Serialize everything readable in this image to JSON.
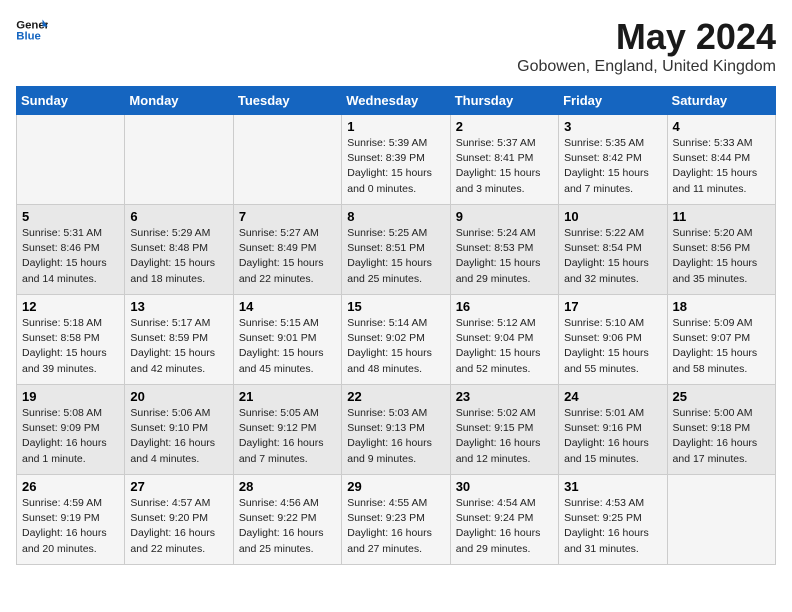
{
  "header": {
    "logo_line1": "General",
    "logo_line2": "Blue",
    "month": "May 2024",
    "location": "Gobowen, England, United Kingdom"
  },
  "weekdays": [
    "Sunday",
    "Monday",
    "Tuesday",
    "Wednesday",
    "Thursday",
    "Friday",
    "Saturday"
  ],
  "weeks": [
    [
      {
        "day": "",
        "info": ""
      },
      {
        "day": "",
        "info": ""
      },
      {
        "day": "",
        "info": ""
      },
      {
        "day": "1",
        "info": "Sunrise: 5:39 AM\nSunset: 8:39 PM\nDaylight: 15 hours\nand 0 minutes."
      },
      {
        "day": "2",
        "info": "Sunrise: 5:37 AM\nSunset: 8:41 PM\nDaylight: 15 hours\nand 3 minutes."
      },
      {
        "day": "3",
        "info": "Sunrise: 5:35 AM\nSunset: 8:42 PM\nDaylight: 15 hours\nand 7 minutes."
      },
      {
        "day": "4",
        "info": "Sunrise: 5:33 AM\nSunset: 8:44 PM\nDaylight: 15 hours\nand 11 minutes."
      }
    ],
    [
      {
        "day": "5",
        "info": "Sunrise: 5:31 AM\nSunset: 8:46 PM\nDaylight: 15 hours\nand 14 minutes."
      },
      {
        "day": "6",
        "info": "Sunrise: 5:29 AM\nSunset: 8:48 PM\nDaylight: 15 hours\nand 18 minutes."
      },
      {
        "day": "7",
        "info": "Sunrise: 5:27 AM\nSunset: 8:49 PM\nDaylight: 15 hours\nand 22 minutes."
      },
      {
        "day": "8",
        "info": "Sunrise: 5:25 AM\nSunset: 8:51 PM\nDaylight: 15 hours\nand 25 minutes."
      },
      {
        "day": "9",
        "info": "Sunrise: 5:24 AM\nSunset: 8:53 PM\nDaylight: 15 hours\nand 29 minutes."
      },
      {
        "day": "10",
        "info": "Sunrise: 5:22 AM\nSunset: 8:54 PM\nDaylight: 15 hours\nand 32 minutes."
      },
      {
        "day": "11",
        "info": "Sunrise: 5:20 AM\nSunset: 8:56 PM\nDaylight: 15 hours\nand 35 minutes."
      }
    ],
    [
      {
        "day": "12",
        "info": "Sunrise: 5:18 AM\nSunset: 8:58 PM\nDaylight: 15 hours\nand 39 minutes."
      },
      {
        "day": "13",
        "info": "Sunrise: 5:17 AM\nSunset: 8:59 PM\nDaylight: 15 hours\nand 42 minutes."
      },
      {
        "day": "14",
        "info": "Sunrise: 5:15 AM\nSunset: 9:01 PM\nDaylight: 15 hours\nand 45 minutes."
      },
      {
        "day": "15",
        "info": "Sunrise: 5:14 AM\nSunset: 9:02 PM\nDaylight: 15 hours\nand 48 minutes."
      },
      {
        "day": "16",
        "info": "Sunrise: 5:12 AM\nSunset: 9:04 PM\nDaylight: 15 hours\nand 52 minutes."
      },
      {
        "day": "17",
        "info": "Sunrise: 5:10 AM\nSunset: 9:06 PM\nDaylight: 15 hours\nand 55 minutes."
      },
      {
        "day": "18",
        "info": "Sunrise: 5:09 AM\nSunset: 9:07 PM\nDaylight: 15 hours\nand 58 minutes."
      }
    ],
    [
      {
        "day": "19",
        "info": "Sunrise: 5:08 AM\nSunset: 9:09 PM\nDaylight: 16 hours\nand 1 minute."
      },
      {
        "day": "20",
        "info": "Sunrise: 5:06 AM\nSunset: 9:10 PM\nDaylight: 16 hours\nand 4 minutes."
      },
      {
        "day": "21",
        "info": "Sunrise: 5:05 AM\nSunset: 9:12 PM\nDaylight: 16 hours\nand 7 minutes."
      },
      {
        "day": "22",
        "info": "Sunrise: 5:03 AM\nSunset: 9:13 PM\nDaylight: 16 hours\nand 9 minutes."
      },
      {
        "day": "23",
        "info": "Sunrise: 5:02 AM\nSunset: 9:15 PM\nDaylight: 16 hours\nand 12 minutes."
      },
      {
        "day": "24",
        "info": "Sunrise: 5:01 AM\nSunset: 9:16 PM\nDaylight: 16 hours\nand 15 minutes."
      },
      {
        "day": "25",
        "info": "Sunrise: 5:00 AM\nSunset: 9:18 PM\nDaylight: 16 hours\nand 17 minutes."
      }
    ],
    [
      {
        "day": "26",
        "info": "Sunrise: 4:59 AM\nSunset: 9:19 PM\nDaylight: 16 hours\nand 20 minutes."
      },
      {
        "day": "27",
        "info": "Sunrise: 4:57 AM\nSunset: 9:20 PM\nDaylight: 16 hours\nand 22 minutes."
      },
      {
        "day": "28",
        "info": "Sunrise: 4:56 AM\nSunset: 9:22 PM\nDaylight: 16 hours\nand 25 minutes."
      },
      {
        "day": "29",
        "info": "Sunrise: 4:55 AM\nSunset: 9:23 PM\nDaylight: 16 hours\nand 27 minutes."
      },
      {
        "day": "30",
        "info": "Sunrise: 4:54 AM\nSunset: 9:24 PM\nDaylight: 16 hours\nand 29 minutes."
      },
      {
        "day": "31",
        "info": "Sunrise: 4:53 AM\nSunset: 9:25 PM\nDaylight: 16 hours\nand 31 minutes."
      },
      {
        "day": "",
        "info": ""
      }
    ]
  ]
}
